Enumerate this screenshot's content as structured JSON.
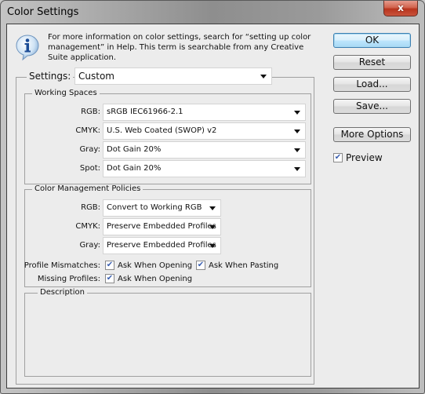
{
  "window": {
    "title": "Color Settings",
    "close_label": "x"
  },
  "info": {
    "icon": "info-icon",
    "text": "For more information on color settings, search for “setting up color management” in Help. This term is searchable from any Creative Suite application."
  },
  "settings": {
    "label": "Settings:",
    "value": "Custom"
  },
  "working_spaces": {
    "title": "Working Spaces",
    "fields": [
      {
        "label": "RGB:",
        "value": "sRGB IEC61966-2.1"
      },
      {
        "label": "CMYK:",
        "value": "U.S. Web Coated (SWOP) v2"
      },
      {
        "label": "Gray:",
        "value": "Dot Gain 20%"
      },
      {
        "label": "Spot:",
        "value": "Dot Gain 20%"
      }
    ]
  },
  "policies": {
    "title": "Color Management Policies",
    "fields": [
      {
        "label": "RGB:",
        "value": "Convert to Working RGB"
      },
      {
        "label": "CMYK:",
        "value": "Preserve Embedded Profiles"
      },
      {
        "label": "Gray:",
        "value": "Preserve Embedded Profiles"
      }
    ],
    "profile_mismatches": {
      "label": "Profile Mismatches:",
      "ask_opening": {
        "label": "Ask When Opening",
        "checked": true
      },
      "ask_pasting": {
        "label": "Ask When Pasting",
        "checked": true
      }
    },
    "missing_profiles": {
      "label": "Missing Profiles:",
      "ask_opening": {
        "label": "Ask When Opening",
        "checked": true
      }
    }
  },
  "description": {
    "title": "Description",
    "text": ""
  },
  "buttons": {
    "ok": "OK",
    "reset": "Reset",
    "load": "Load...",
    "save": "Save...",
    "more_options": "More Options"
  },
  "preview": {
    "label": "Preview",
    "checked": true
  },
  "check_glyph": "✔"
}
